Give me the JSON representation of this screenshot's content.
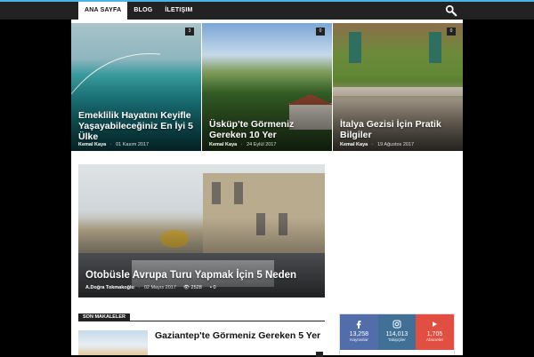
{
  "nav": {
    "items": [
      "Ana Sayfa",
      "Blog",
      "İletişim"
    ]
  },
  "featured": [
    {
      "title": "Emeklilik Hayatını Keyifle Yaşayabileceğiniz En İyi 5 Ülke",
      "author": "Kemal Kaya",
      "date": "01 Kasım 2017",
      "comments": "3"
    },
    {
      "title": "Üsküp'te Görmeniz Gereken 10 Yer",
      "author": "Kemal Kaya",
      "date": "24 Eylül 2017",
      "comments": "0"
    },
    {
      "title": "İtalya Gezisi İçin Pratik Bilgiler",
      "author": "Kemal Kaya",
      "date": "19 Ağustos 2017",
      "comments": "0"
    }
  ],
  "big_post": {
    "title": "Otobüsle Avrupa Turu Yapmak İçin 5 Neden",
    "author": "A.Doğra Tokmakoğlu",
    "date": "02 Mayıs 2017",
    "views": "2528",
    "comments": "0"
  },
  "recent": {
    "section_title": "Son Makaleler",
    "article_title": "Gaziantep'te Görmeniz Gereken 5 Yer"
  },
  "social": [
    {
      "icon": "facebook-icon",
      "count": "13,258",
      "label": "Hayranlar",
      "color": "#516eab"
    },
    {
      "icon": "instagram-icon",
      "count": "114,013",
      "label": "Takipçiler",
      "color": "#417096"
    },
    {
      "icon": "youtube-icon",
      "count": "1,705",
      "label": "Abuneler",
      "color": "#e14e42"
    }
  ]
}
